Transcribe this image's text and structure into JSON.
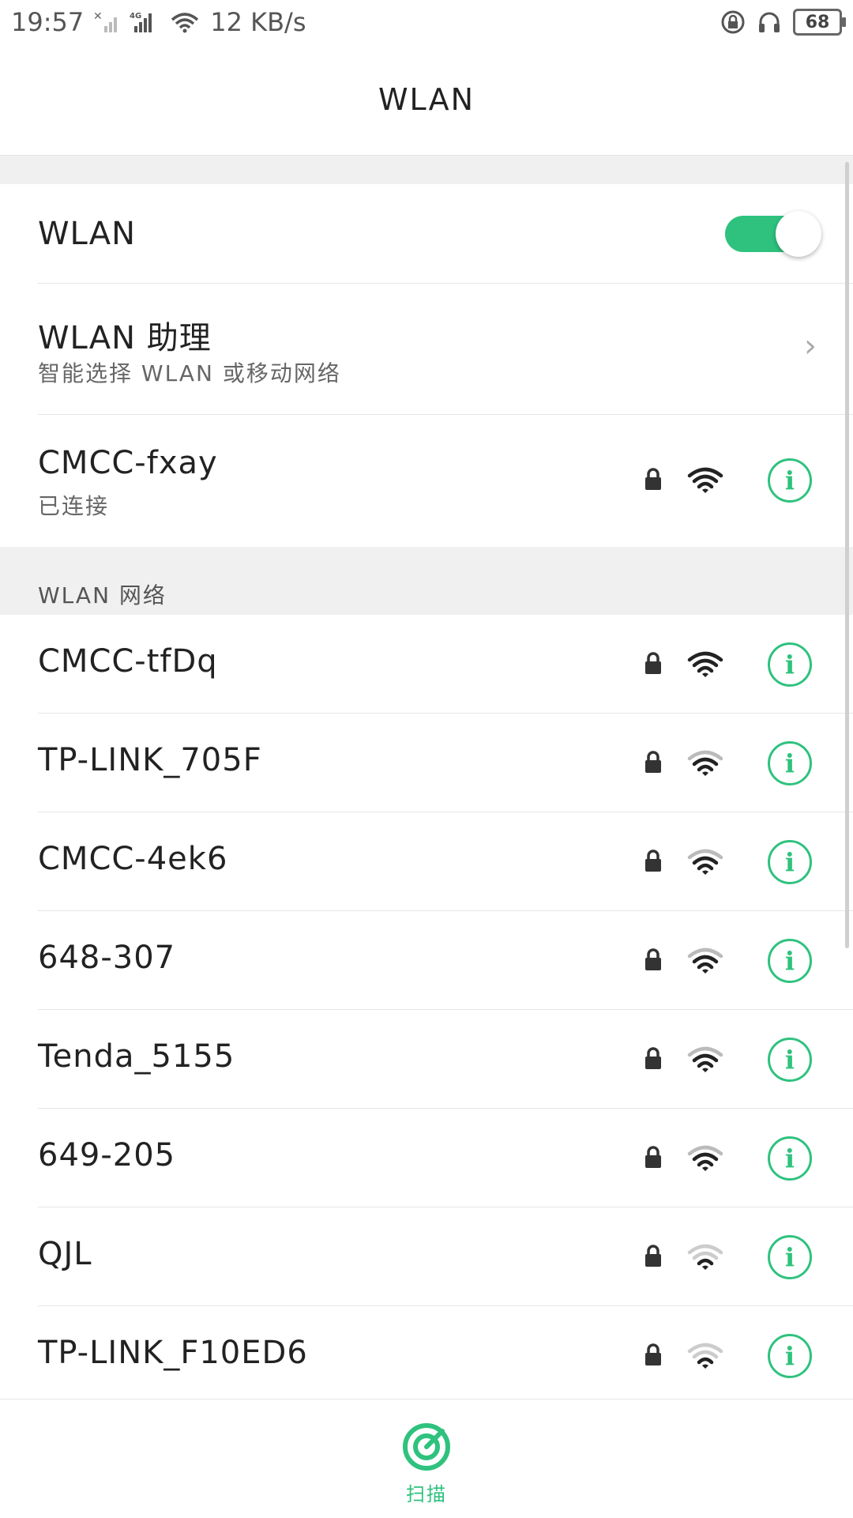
{
  "status_bar": {
    "time": "19:57",
    "speed": "12 KB/s",
    "battery": "68"
  },
  "header": {
    "title": "WLAN"
  },
  "wlan_toggle": {
    "label": "WLAN",
    "state": "on",
    "accent": "#2ec27e"
  },
  "assistant": {
    "title": "WLAN 助理",
    "subtitle": "智能选择 WLAN 或移动网络"
  },
  "connected": {
    "ssid": "CMCC-fxay",
    "status": "已连接"
  },
  "networks_section": {
    "title": "WLAN 网络"
  },
  "networks": [
    {
      "ssid": "CMCC-tfDq",
      "secured": true,
      "signal": 4
    },
    {
      "ssid": "TP-LINK_705F",
      "secured": true,
      "signal": 3
    },
    {
      "ssid": "CMCC-4ek6",
      "secured": true,
      "signal": 3
    },
    {
      "ssid": "648-307",
      "secured": true,
      "signal": 3
    },
    {
      "ssid": "Tenda_5155",
      "secured": true,
      "signal": 3
    },
    {
      "ssid": "649-205",
      "secured": true,
      "signal": 3
    },
    {
      "ssid": "QJL",
      "secured": true,
      "signal": 2
    },
    {
      "ssid": "TP-LINK_F10ED6",
      "secured": true,
      "signal": 2
    }
  ],
  "bottom": {
    "scan_label": "扫描"
  }
}
